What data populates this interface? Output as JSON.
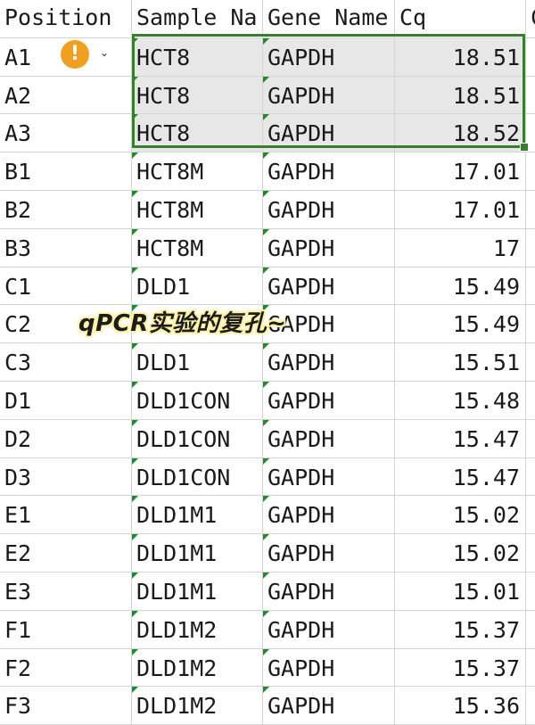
{
  "headers": {
    "position": "Position",
    "sample": "Sample Na",
    "gene": "Gene Name",
    "cq": "Cq",
    "extra": "C"
  },
  "rows": [
    {
      "position": "A1",
      "sample": "HCT8",
      "gene": "GAPDH",
      "cq": "18.51"
    },
    {
      "position": "A2",
      "sample": "HCT8",
      "gene": "GAPDH",
      "cq": "18.51"
    },
    {
      "position": "A3",
      "sample": "HCT8",
      "gene": "GAPDH",
      "cq": "18.52"
    },
    {
      "position": "B1",
      "sample": "HCT8M",
      "gene": "GAPDH",
      "cq": "17.01"
    },
    {
      "position": "B2",
      "sample": "HCT8M",
      "gene": "GAPDH",
      "cq": "17.01"
    },
    {
      "position": "B3",
      "sample": "HCT8M",
      "gene": "GAPDH",
      "cq": "17"
    },
    {
      "position": "C1",
      "sample": "DLD1",
      "gene": "GAPDH",
      "cq": "15.49"
    },
    {
      "position": "C2",
      "sample": "",
      "gene": "GAPDH",
      "cq": "15.49"
    },
    {
      "position": "C3",
      "sample": "DLD1",
      "gene": "GAPDH",
      "cq": "15.51"
    },
    {
      "position": "D1",
      "sample": "DLD1CON",
      "gene": "GAPDH",
      "cq": "15.48"
    },
    {
      "position": "D2",
      "sample": "DLD1CON",
      "gene": "GAPDH",
      "cq": "15.47"
    },
    {
      "position": "D3",
      "sample": "DLD1CON",
      "gene": "GAPDH",
      "cq": "15.47"
    },
    {
      "position": "E1",
      "sample": "DLD1M1",
      "gene": "GAPDH",
      "cq": "15.02"
    },
    {
      "position": "E2",
      "sample": "DLD1M1",
      "gene": "GAPDH",
      "cq": "15.02"
    },
    {
      "position": "E3",
      "sample": "DLD1M1",
      "gene": "GAPDH",
      "cq": "15.01"
    },
    {
      "position": "F1",
      "sample": "DLD1M2",
      "gene": "GAPDH",
      "cq": "15.37"
    },
    {
      "position": "F2",
      "sample": "DLD1M2",
      "gene": "GAPDH",
      "cq": "15.37"
    },
    {
      "position": "F3",
      "sample": "DLD1M2",
      "gene": "GAPDH",
      "cq": "15.36"
    }
  ],
  "warning": {
    "glyph": "!",
    "caret": "⌄"
  },
  "caption": "qPCR实验的复孔~",
  "colors": {
    "selection_border": "#3a7d31",
    "selection_fill": "#e7e7e7",
    "warning": "#f0a020",
    "triangle_flag": "#1e8a2e"
  }
}
